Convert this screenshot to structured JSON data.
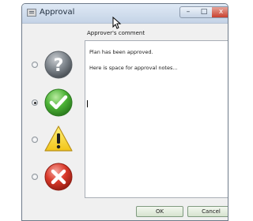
{
  "window": {
    "title": "Approval"
  },
  "titlebar_buttons": {
    "min": "–",
    "max": "□",
    "close": "x"
  },
  "form": {
    "label": "Approver's comment",
    "notes_line1": "Plan has been approved.",
    "notes_line2": "Here is space for approval notes..."
  },
  "statuses": [
    {
      "icon": "question-icon",
      "checked": false
    },
    {
      "icon": "check-icon",
      "checked": true
    },
    {
      "icon": "warning-icon",
      "checked": false
    },
    {
      "icon": "error-x-icon",
      "checked": false
    }
  ],
  "buttons": {
    "ok": "OK",
    "cancel": "Cancel"
  }
}
